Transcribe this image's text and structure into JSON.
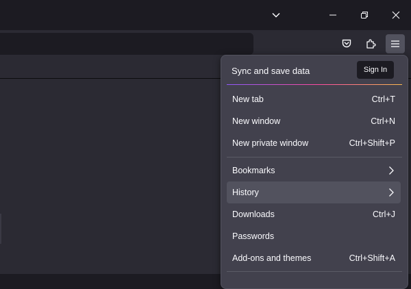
{
  "window_controls": {
    "list_all_tabs": "chevron-down-icon",
    "minimize": "minimize-icon",
    "restore": "restore-icon",
    "close": "close-icon"
  },
  "toolbar": {
    "pocket": "pocket-icon",
    "extensions": "puzzle-icon",
    "menu": "hamburger-menu-icon"
  },
  "menu": {
    "sync_title": "Sync and save data",
    "sign_in": "Sign In",
    "items": [
      {
        "label": "New tab",
        "shortcut": "Ctrl+T"
      },
      {
        "label": "New window",
        "shortcut": "Ctrl+N"
      },
      {
        "label": "New private window",
        "shortcut": "Ctrl+Shift+P"
      },
      {
        "label": "Bookmarks",
        "shortcut": ""
      },
      {
        "label": "History",
        "shortcut": ""
      },
      {
        "label": "Downloads",
        "shortcut": "Ctrl+J"
      },
      {
        "label": "Passwords",
        "shortcut": ""
      },
      {
        "label": "Add-ons and themes",
        "shortcut": "Ctrl+Shift+A"
      }
    ]
  },
  "colors": {
    "titlebar": "#1c1b22",
    "toolbar": "#2b2a33",
    "panel": "#42414d",
    "hover": "#52525e",
    "accent_gradient": [
      "#9059ff",
      "#ff4aa2",
      "#ffbd4f"
    ]
  }
}
